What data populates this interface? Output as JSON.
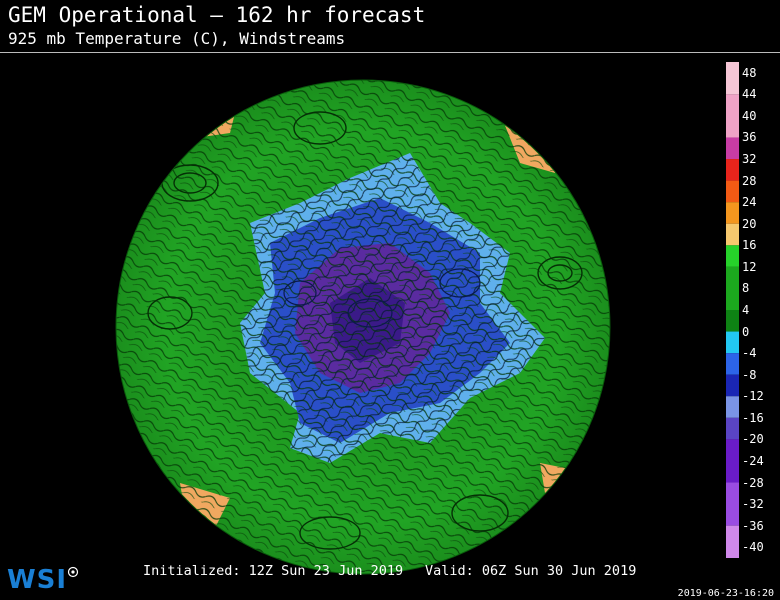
{
  "header": {
    "title": "GEM Operational — 162 hr forecast",
    "subtitle": "925 mb Temperature (C), Windstreams"
  },
  "footer": {
    "initialized": "Initialized: 12Z Sun 23 Jun 2019",
    "valid": "Valid: 06Z Sun 30 Jun 2019",
    "timestamp": "2019-06-23-16:20"
  },
  "logo": {
    "text": "WSI"
  },
  "colorbar": {
    "labels": [
      "48",
      "44",
      "40",
      "36",
      "32",
      "28",
      "24",
      "20",
      "16",
      "12",
      "8",
      "4",
      "0",
      "-4",
      "-8",
      "-12",
      "-16",
      "-20",
      "-24",
      "-28",
      "-32",
      "-36",
      "-40"
    ],
    "min": -42,
    "max": 50,
    "bands": [
      {
        "from": 44,
        "to": 50,
        "color": "#f6c6d6"
      },
      {
        "from": 36,
        "to": 44,
        "color": "#f0a2c6"
      },
      {
        "from": 32,
        "to": 36,
        "color": "#c83ca4"
      },
      {
        "from": 28,
        "to": 32,
        "color": "#e8241c"
      },
      {
        "from": 24,
        "to": 28,
        "color": "#f25a14"
      },
      {
        "from": 20,
        "to": 24,
        "color": "#f4961e"
      },
      {
        "from": 16,
        "to": 20,
        "color": "#f6c86e"
      },
      {
        "from": 12,
        "to": 16,
        "color": "#26d22a"
      },
      {
        "from": 4,
        "to": 12,
        "color": "#1ca81e"
      },
      {
        "from": 0,
        "to": 4,
        "color": "#0e8214"
      },
      {
        "from": -4,
        "to": 0,
        "color": "#22c8f2"
      },
      {
        "from": -8,
        "to": -4,
        "color": "#2c64e8"
      },
      {
        "from": -12,
        "to": -8,
        "color": "#1a26b4"
      },
      {
        "from": -16,
        "to": -12,
        "color": "#7a94e6"
      },
      {
        "from": -20,
        "to": -16,
        "color": "#5a44c4"
      },
      {
        "from": -28,
        "to": -20,
        "color": "#6a1cc8"
      },
      {
        "from": -36,
        "to": -28,
        "color": "#9a4ce2"
      },
      {
        "from": -42,
        "to": -36,
        "color": "#d088ea"
      }
    ]
  },
  "map_colors": {
    "warm": "#1f9a21",
    "cold_outer": "#5fb0ec",
    "cold_mid": "#2a4fc8",
    "cold_inner": "#5a2ba0",
    "hot": "#f0a860",
    "background": "#000000"
  }
}
